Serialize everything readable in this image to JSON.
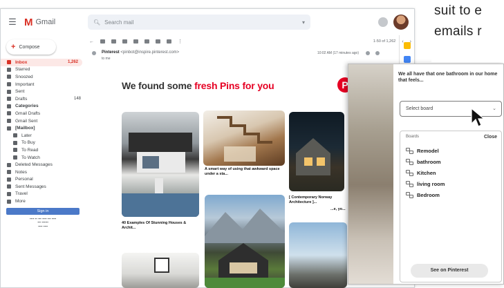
{
  "article": {
    "lines": [
      "suit to e",
      "emails r"
    ]
  },
  "gmail": {
    "app_name": "Gmail",
    "search_placeholder": "Search mail",
    "compose_label": "Compose",
    "sidebar": [
      {
        "label": "Inbox",
        "count": "1,262",
        "active": true
      },
      {
        "label": "Starred"
      },
      {
        "label": "Snoozed"
      },
      {
        "label": "Important"
      },
      {
        "label": "Sent"
      },
      {
        "label": "Drafts",
        "count": "148"
      },
      {
        "label": "Categories",
        "bold": true
      },
      {
        "label": "Gmail Drafts"
      },
      {
        "label": "Gmail Sent"
      },
      {
        "label": "[Mailbox]",
        "bold": true
      },
      {
        "label": "Later",
        "sub": true
      },
      {
        "label": "To Buy",
        "sub": true
      },
      {
        "label": "To Read",
        "sub": true
      },
      {
        "label": "To Watch",
        "sub": true
      },
      {
        "label": "Deleted Messages"
      },
      {
        "label": "Notes"
      },
      {
        "label": "Personal"
      },
      {
        "label": "Sent Messages"
      },
      {
        "label": "Travel"
      },
      {
        "label": "More"
      }
    ],
    "signin_label": "Sign in",
    "toolbar_range": "1-50 of 1,262",
    "message": {
      "from_name": "Pinterest",
      "from_addr": "<pinbot@inspire.pinterest.com>",
      "to": "to me",
      "date": "10:02 AM (17 minutes ago)"
    },
    "email": {
      "headline_start": "We found some ",
      "headline_highlight": "fresh Pins for you",
      "pin_captions": [
        "40 Examples Of Stunning Houses & Archit...",
        "A smart way of using that awkward space under a sta...",
        "[ Contemporary Norway Architecture ]...",
        "...e, yo..."
      ]
    }
  },
  "pinterest": {
    "description": "We all have that one bathroom in our home that feels...",
    "select_placeholder": "Select board",
    "boards_header": "Boards",
    "close_label": "Close",
    "boards": [
      "Remodel",
      "bathroom",
      "Kitchen",
      "living room",
      "Bedroom"
    ],
    "see_button": "See on Pinterest"
  },
  "colors": {
    "gmail_red": "#d93025",
    "pinterest_red": "#e60023",
    "signin_blue": "#4b79c8"
  }
}
